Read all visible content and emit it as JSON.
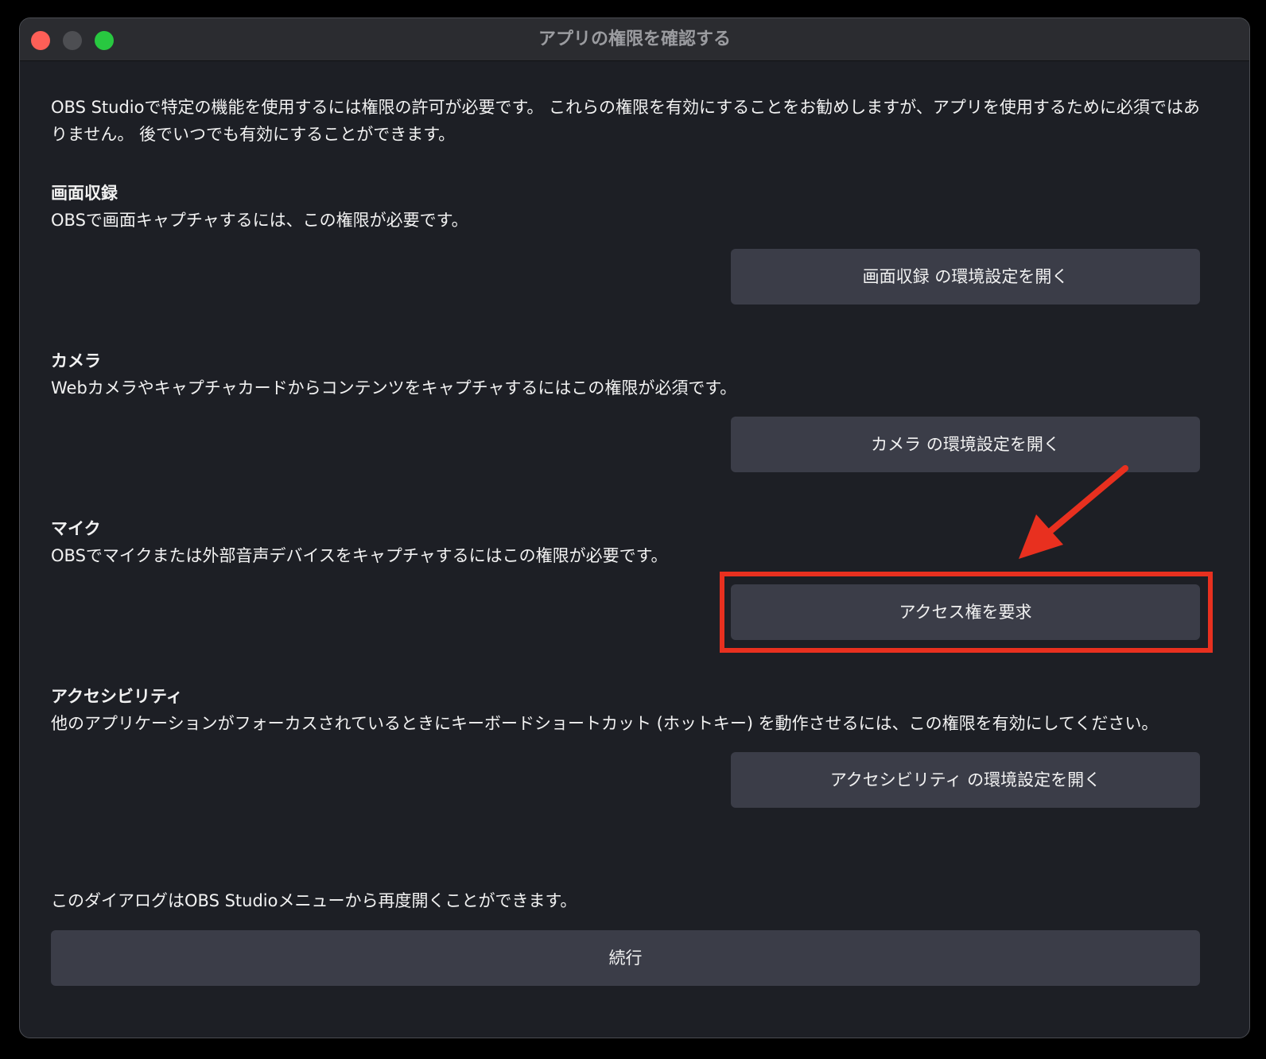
{
  "window": {
    "title": "アプリの権限を確認する"
  },
  "intro": {
    "text": "OBS Studioで特定の機能を使用するには権限の許可が必要です。 これらの権限を有効にすることをお勧めしますが、アプリを使用するために必須ではありません。 後でいつでも有効にすることができます。"
  },
  "sections": [
    {
      "title": "画面収録",
      "description": "OBSで画面キャプチャするには、この権限が必要です。",
      "button_label": "画面収録 の環境設定を開く"
    },
    {
      "title": "カメラ",
      "description": "Webカメラやキャプチャカードからコンテンツをキャプチャするにはこの権限が必須です。",
      "button_label": "カメラ の環境設定を開く"
    },
    {
      "title": "マイク",
      "description": "OBSでマイクまたは外部音声デバイスをキャプチャするにはこの権限が必要です。",
      "button_label": "アクセス権を要求"
    },
    {
      "title": "アクセシビリティ",
      "description": "他のアプリケーションがフォーカスされているときにキーボードショートカット (ホットキー) を動作させるには、この権限を有効にしてください。",
      "button_label": "アクセシビリティ の環境設定を開く"
    }
  ],
  "footer": {
    "note": "このダイアログはOBS Studioメニューから再度開くことができます。",
    "continue_label": "続行"
  },
  "colors": {
    "window_bg": "#1d1f25",
    "button_bg": "#3b3d48",
    "annotation_red": "#e8301f"
  }
}
